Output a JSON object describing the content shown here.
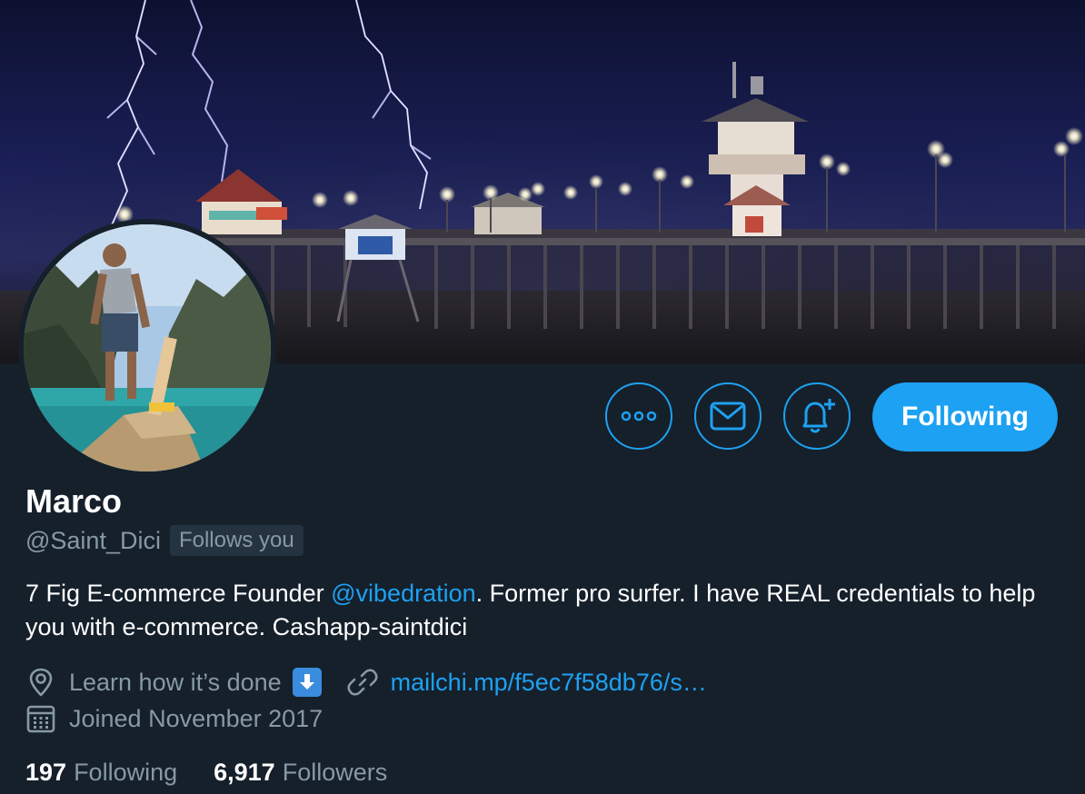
{
  "profile": {
    "name": "Marco",
    "handle": "@Saint_Dici",
    "follows_you_badge": "Follows you",
    "bio": {
      "before_mention": "7 Fig E-commerce Founder ",
      "mention": "@vibedration",
      "after_mention": ". Former pro surfer. I have REAL credentials to help you with e-commerce. Cashapp-saintdici"
    },
    "location": "Learn how it’s done",
    "website": "mailchi.mp/f5ec7f58db76/s…",
    "joined": "Joined November 2017",
    "stats": {
      "following_count": "197",
      "following_label": "Following",
      "followers_count": "6,917",
      "followers_label": "Followers"
    }
  },
  "actions": {
    "more_icon": "more-dots-icon",
    "message_icon": "envelope-icon",
    "notify_icon": "bell-plus-icon",
    "follow_button_label": "Following"
  },
  "colors": {
    "background": "#15202b",
    "accent": "#1da1f2",
    "secondary_text": "#8899a6",
    "primary_text": "#ffffff"
  }
}
